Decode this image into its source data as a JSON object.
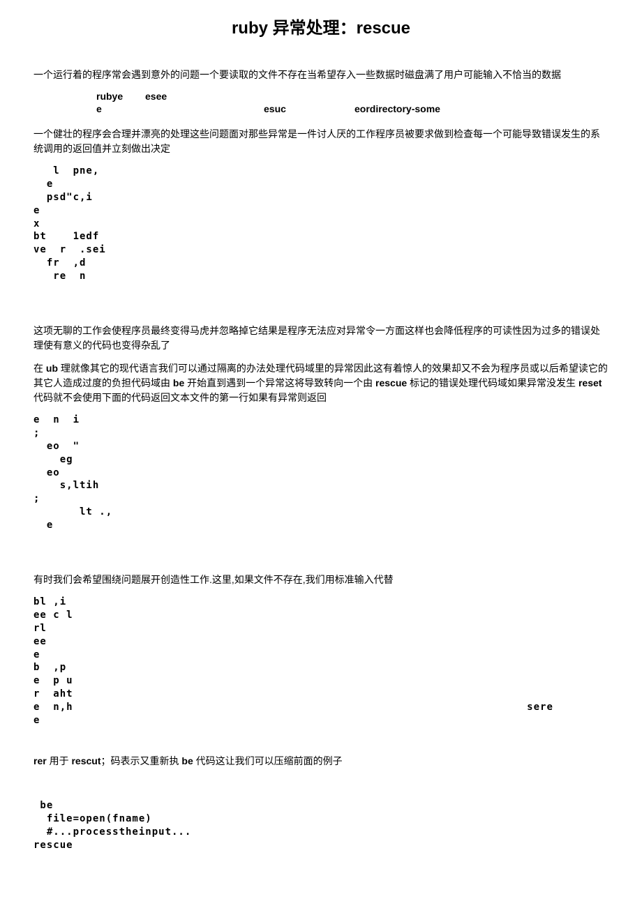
{
  "title": "ruby 异常处理：rescue",
  "p1": "一个运行着的程序常会遇到意外的问题一个要读取的文件不存在当希望存入一些数据时磁盘满了用户可能输入不恰当的数据",
  "row1": {
    "a": "rubye",
    "b": "esee",
    "c": "",
    "d": ""
  },
  "row2": {
    "a": "e",
    "b": "",
    "c": "esuc",
    "d": "eordirectory-some"
  },
  "p2": "一个健壮的程序会合理并漂亮的处理这些问题面对那些异常是一件讨人厌的工作程序员被要求做到检查每一个可能导致错误发生的系统调用的返回值并立刻做出决定",
  "code1": "   l  pne,\n  e\n  psd\"c,i\ne\nx\nbt    1edf\nve  r  .sei\n  fr  ,d\n   re  n",
  "p3": "这项无聊的工作会使程序员最终变得马虎并忽略掉它结果是程序无法应对异常令一方面这样也会降低程序的可读性因为过多的错误处理使有意义的代码也变得杂乱了",
  "p4_pre": "在 ",
  "p4_b1": "ub",
  "p4_mid1": " 理就像其它的现代语言我们可以通过隔离的办法处理代码域里的异常因此这有着惊人的效果却又不会为程序员或以后希望读它的其它人造成过度的负担代码域由 ",
  "p4_b2": "be",
  "p4_mid2": " 开始直到遇到一个异常这将导致转向一个由 ",
  "p4_b3": "rescue",
  "p4_mid3": " 标记的错误处理代码域如果异常没发生 ",
  "p4_b4": "reset",
  "p4_mid4": " 代码就不会使用下面的代码返回文本文件的第一行如果有异常则返回",
  "code2": "e  n  i\n;\n  eo  \"\n    eg\n  eo\n    s,ltih\n;\n       lt .,\n  e",
  "p5": "有时我们会希望围绕问题展开创造性工作.这里,如果文件不存在,我们用标准输入代替",
  "code3": "bl ,i\nee c l\nrl\nee\ne\nb  ,p\ne  p u\nr  aht\ne  n,h                                                                     sere\ne",
  "p6_b1": "rer",
  "p6_t1": " 用于 ",
  "p6_b2": "rescut",
  "p6_t2": "；码表示又重新执 ",
  "p6_b3": "be",
  "p6_t3": " 代码这让我们可以压缩前面的例子",
  "code4": " be\n  file=open(fname)\n  #...processtheinput...\nrescue"
}
